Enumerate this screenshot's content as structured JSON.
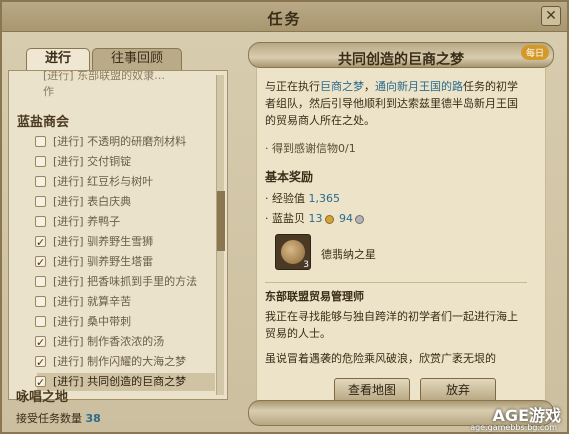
{
  "window": {
    "title": "任务",
    "close_label": "✕"
  },
  "tabs": [
    {
      "label": "进行"
    },
    {
      "label": "往事回顾"
    }
  ],
  "quest_list": {
    "truncated_top": "[进行] 东部联盟的奴隶…",
    "truncated_top2": "作",
    "groups": [
      {
        "name": "蓝盐商会",
        "items": [
          {
            "label": "[进行] 不透明的研磨剂材料",
            "checked": false
          },
          {
            "label": "[进行] 交付铜锭",
            "checked": false
          },
          {
            "label": "[进行] 红豆杉与树叶",
            "checked": false
          },
          {
            "label": "[进行] 表白庆典",
            "checked": false
          },
          {
            "label": "[进行] 养鸭子",
            "checked": false
          },
          {
            "label": "[进行] 驯养野生雪狮",
            "checked": true
          },
          {
            "label": "[进行] 驯养野生塔雷",
            "checked": true
          },
          {
            "label": "[进行] 把香味抓到手里的方法",
            "checked": false
          },
          {
            "label": "[进行] 就算辛苦",
            "checked": false
          },
          {
            "label": "[进行] 桑中带刺",
            "checked": false
          },
          {
            "label": "[进行] 制作香浓浓的汤",
            "checked": true
          },
          {
            "label": "[进行] 制作闪耀的大海之梦",
            "checked": true
          },
          {
            "label": "[进行] 共同创造的巨商之梦",
            "checked": true,
            "selected": true
          }
        ]
      }
    ],
    "footer_group": "咏唱之地",
    "accept_label": "接受任务数量",
    "accept_count": "38"
  },
  "detail": {
    "quest_title": "共同创造的巨商之梦",
    "badge": "每日",
    "desc_parts": {
      "p1": "与正在执行",
      "link1": "巨商之梦",
      "p2": "，",
      "link2": "通向新月王国的路",
      "p3": "任务的初学者组队，然后引导他顺利到达索兹里德半岛新月王国的贸易商人所在之处。"
    },
    "objective": "· 得到感谢信物0/1",
    "rewards_title": "基本奖励",
    "exp_label": "· 经验值",
    "exp_value": "1,365",
    "coin_label": "· 蓝盐贝",
    "coin_gold": "13",
    "coin_silver": "94",
    "item_name": "德翡纳之星",
    "item_count": "3",
    "npc_name": "东部联盟贸易管理师",
    "npc_line1": "我正在寻找能够与独自跨洋的初学者们一起进行海上贸易的人士。",
    "npc_line2": "虽说冒着遇袭的危险乘风破浪，欣赏广袤无垠的",
    "btn_map": "查看地图",
    "btn_abandon": "放弃"
  },
  "watermark": {
    "main": "AGE游戏",
    "sub": "age.gamebbs.bg.com"
  }
}
